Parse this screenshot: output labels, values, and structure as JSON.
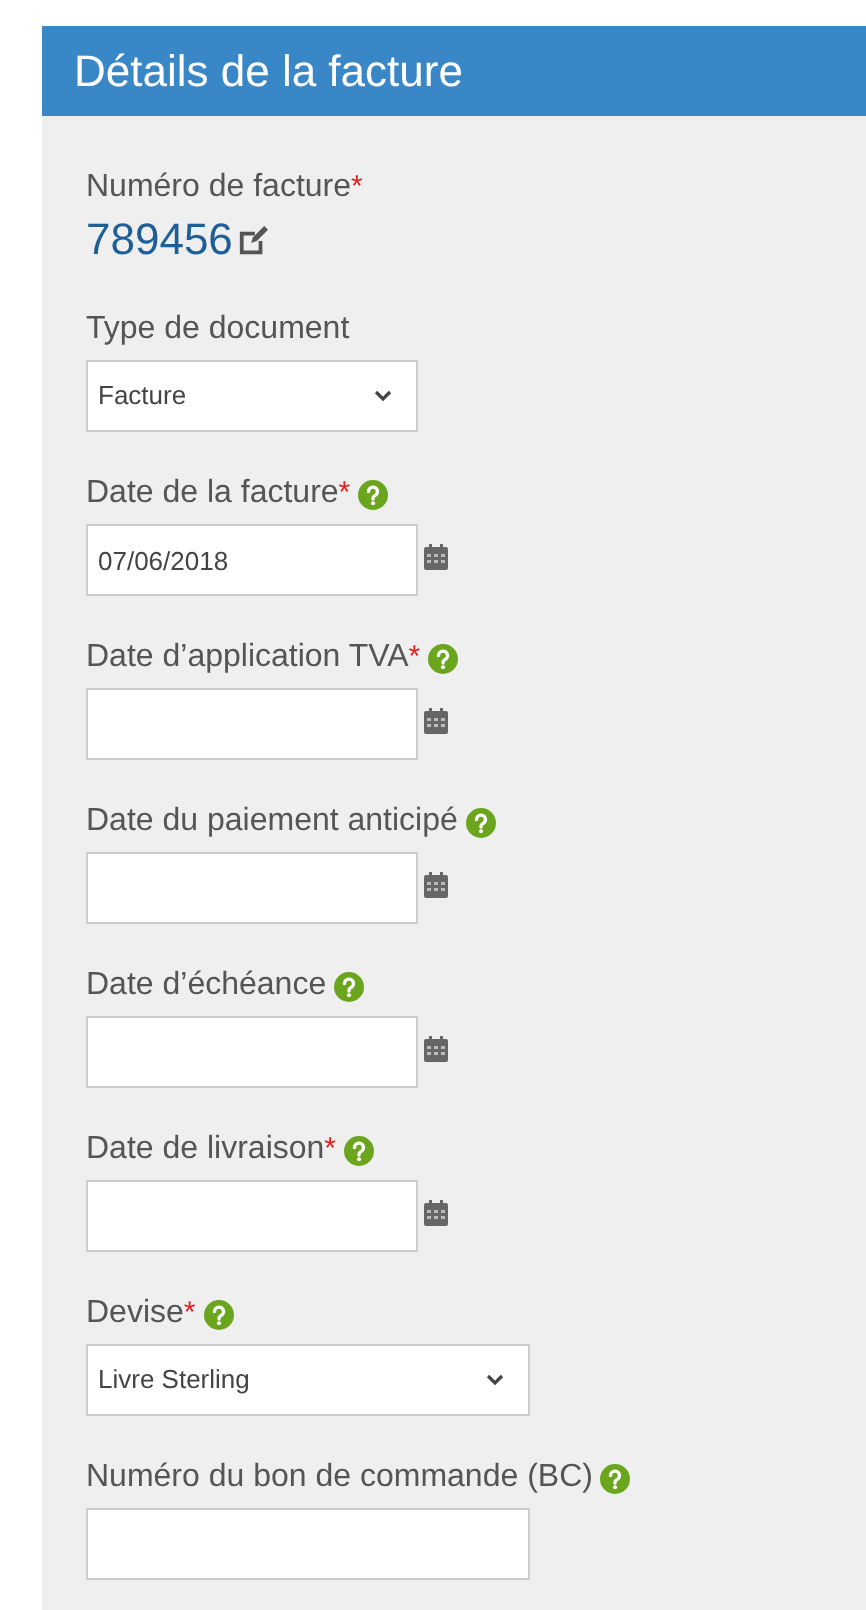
{
  "panel": {
    "title": "Détails de la facture"
  },
  "fields": [
    {
      "kind": "number",
      "label": "Numéro de facture",
      "required_marker": "*",
      "help": false,
      "value": "789456"
    },
    {
      "kind": "select",
      "label": "Type de document",
      "help": false,
      "value": "Facture",
      "wide": false
    },
    {
      "kind": "date",
      "label": "Date de la facture",
      "required_marker": "*",
      "help": true,
      "value": "07/06/2018"
    },
    {
      "kind": "date",
      "label": "Date d’application TVA",
      "required_marker": "*",
      "help": true
    },
    {
      "kind": "date",
      "label": "Date du paiement anticipé",
      "help": true
    },
    {
      "kind": "date",
      "label": "Date d’échéance",
      "help": true
    },
    {
      "kind": "date",
      "label": "Date de livraison",
      "required_marker": "*",
      "help": true
    },
    {
      "kind": "select",
      "label": "Devise",
      "required_marker": "*",
      "help": true,
      "value": "Livre Sterling",
      "wide": true
    },
    {
      "kind": "text",
      "label": "Numéro du bon de commande (BC)",
      "help": true
    }
  ]
}
